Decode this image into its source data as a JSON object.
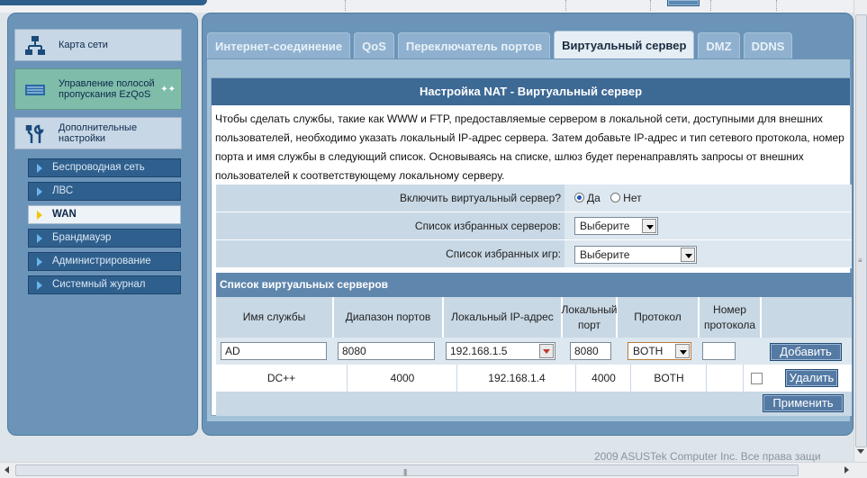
{
  "sidebar": {
    "main_items": [
      {
        "label": "Карта сети",
        "icon": "network-map-icon"
      },
      {
        "label": "Управление полосой пропускания EzQoS",
        "icon": "qos-icon"
      },
      {
        "label": "Дополнительные настройки",
        "icon": "tools-icon"
      }
    ],
    "sub_items": [
      {
        "label": "Беспроводная сеть"
      },
      {
        "label": "ЛВС"
      },
      {
        "label": "WAN"
      },
      {
        "label": "Брандмауэр"
      },
      {
        "label": "Администрирование"
      },
      {
        "label": "Системный журнал"
      }
    ],
    "active_sub": "WAN"
  },
  "tabs": [
    {
      "label": "Интернет-соединение"
    },
    {
      "label": "QoS"
    },
    {
      "label": "Переключатель портов"
    },
    {
      "label": "Виртуальный сервер"
    },
    {
      "label": "DMZ"
    },
    {
      "label": "DDNS"
    }
  ],
  "active_tab": "Виртуальный сервер",
  "panel": {
    "title": "Настройка NAT - Виртуальный сервер",
    "description": "Чтобы сделать службы, такие как WWW и FTP, предоставляемые сервером в локальной сети, доступными для внешних пользователей, необходимо указать локальный IP-адрес сервера. Затем добавьте IP-адрес и тип сетевого протокола, номер порта и имя службы в следующий список. Основываясь на списке, шлюз будет перенаправлять запросы от внешних пользователей к соответствующему локальному серверу.",
    "enable_label": "Включить виртуальный сервер?",
    "enable_yes": "Да",
    "enable_no": "Нет",
    "enable_value": "Да",
    "favorites_servers_label": "Список избранных серверов:",
    "favorites_servers_value": "Выберите",
    "favorites_games_label": "Список избранных игр:",
    "favorites_games_value": "Выберите",
    "list_title": "Список виртуальных серверов",
    "columns": [
      "Имя службы",
      "Диапазон портов",
      "Локальный IP-адрес",
      "Локальный порт",
      "Протокол",
      "Номер протокола"
    ],
    "input_row": {
      "service": "AD",
      "port_range": "8080",
      "local_ip": "192.168.1.5",
      "local_port": "8080",
      "protocol": "BOTH",
      "protocol_num": ""
    },
    "add_button": "Добавить",
    "rows": [
      {
        "service": "DC++",
        "port_range": "4000",
        "local_ip": "192.168.1.4",
        "local_port": "4000",
        "protocol": "BOTH",
        "protocol_num": ""
      }
    ],
    "delete_button": "Удалить",
    "apply_button": "Применить"
  },
  "footer": "2009 ASUSTek Computer Inc. Все права защи"
}
